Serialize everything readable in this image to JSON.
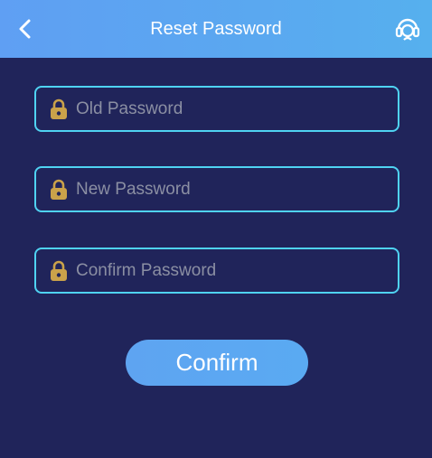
{
  "header": {
    "title": "Reset Password",
    "back_icon": "chevron-left-icon",
    "support_icon": "customer-service-icon",
    "background": "#5aa8f0"
  },
  "form": {
    "fields": [
      {
        "name": "old-password",
        "placeholder": "Old Password",
        "icon": "lock-icon"
      },
      {
        "name": "new-password",
        "placeholder": "New Password",
        "icon": "lock-icon"
      },
      {
        "name": "confirm-password",
        "placeholder": "Confirm Password",
        "icon": "lock-icon"
      }
    ],
    "border_color": "#4fd3f2",
    "lock_color": "#caa24a"
  },
  "confirm_button": {
    "label": "Confirm",
    "color": "#5aaaf2"
  },
  "page_background": "#20245a"
}
